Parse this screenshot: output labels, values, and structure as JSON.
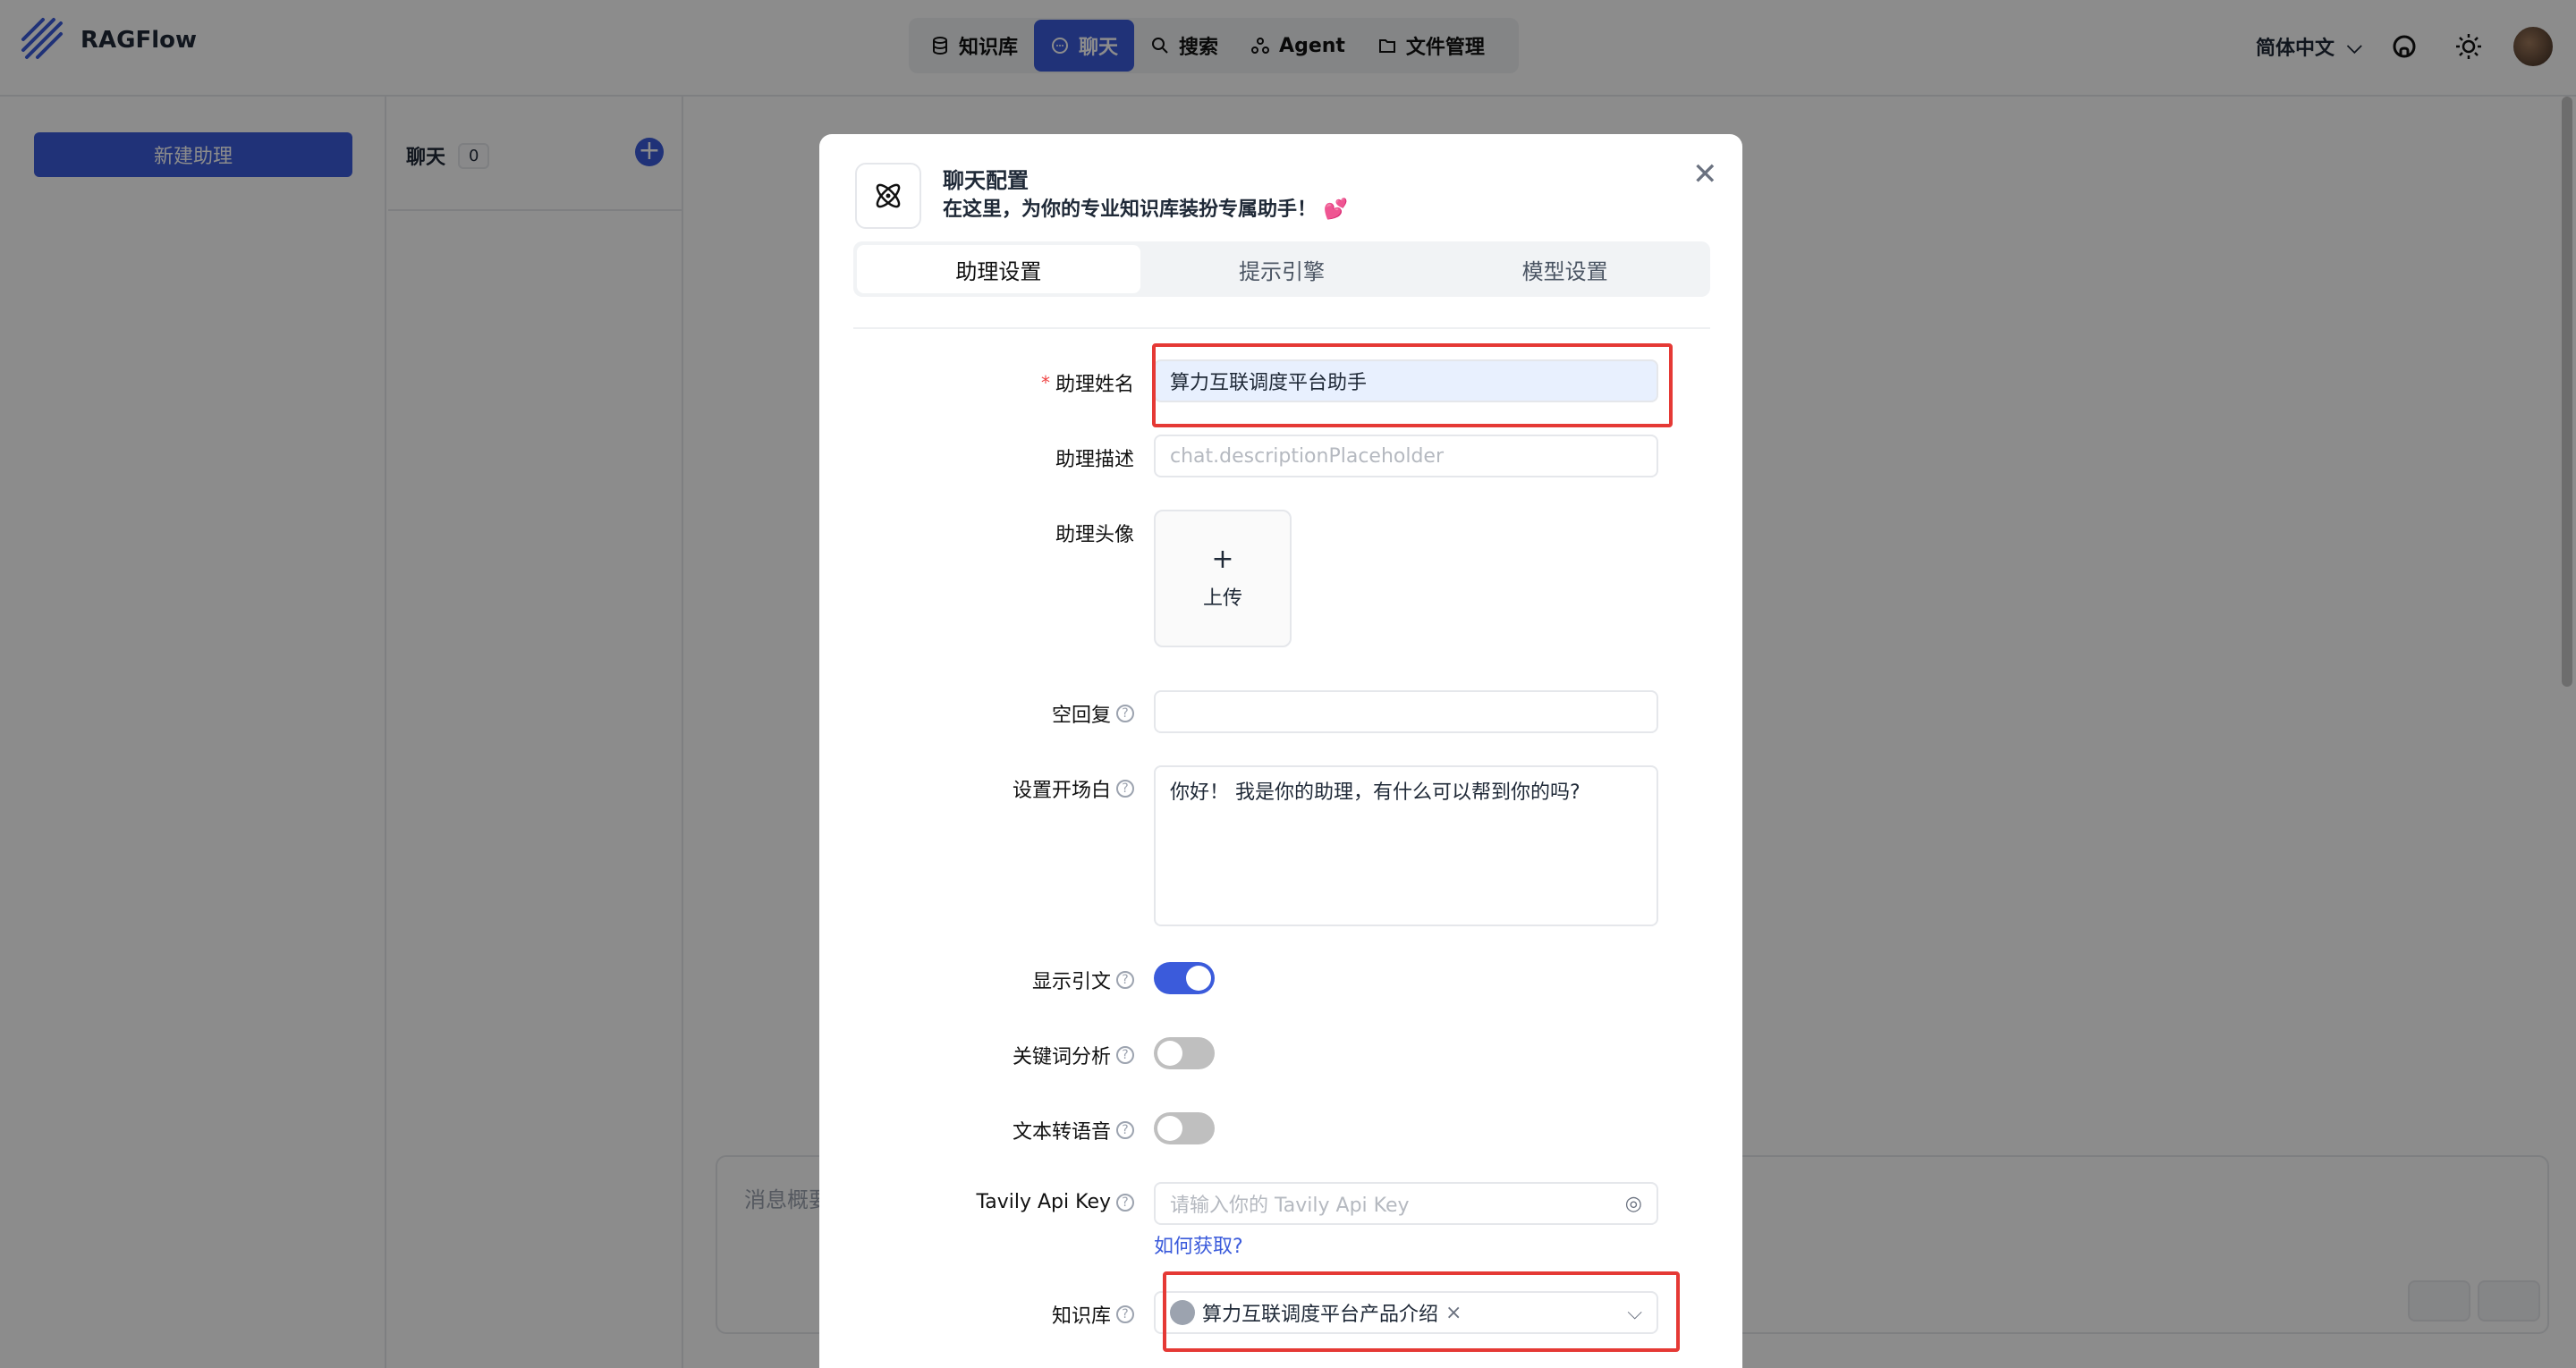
{
  "app": {
    "brand": "RAGFlow"
  },
  "nav": {
    "items": [
      {
        "label": "知识库",
        "icon": "database-icon"
      },
      {
        "label": "聊天",
        "icon": "chat-icon",
        "active": true
      },
      {
        "label": "搜索",
        "icon": "search-icon"
      },
      {
        "label": "Agent",
        "icon": "agent-icon"
      },
      {
        "label": "文件管理",
        "icon": "folder-icon"
      }
    ]
  },
  "header": {
    "language": "简体中文"
  },
  "sidebar": {
    "new_assistant": "新建助理"
  },
  "chats": {
    "title": "聊天",
    "count": "0"
  },
  "message": {
    "placeholder": "消息概要"
  },
  "modal": {
    "title": "聊天配置",
    "subtitle": "在这里，为你的专业知识库装扮专属助手！ 💕",
    "tabs": [
      "助理设置",
      "提示引擎",
      "模型设置"
    ],
    "fields": {
      "name_label": "助理姓名",
      "name_value": "算力互联调度平台助手",
      "desc_label": "助理描述",
      "desc_placeholder": "chat.descriptionPlaceholder",
      "avatar_label": "助理头像",
      "upload_label": "上传",
      "empty_label": "空回复",
      "opener_label": "设置开场白",
      "opener_value": "你好！ 我是你的助理，有什么可以帮到你的吗?",
      "quote_label": "显示引文",
      "quote_on": true,
      "keyword_label": "关键词分析",
      "keyword_on": false,
      "tts_label": "文本转语音",
      "tts_on": false,
      "tavily_label": "Tavily Api Key",
      "tavily_placeholder": "请输入你的 Tavily Api Key",
      "tavily_link": "如何获取?",
      "kb_label": "知识库",
      "kb_value": "算力互联调度平台产品介绍"
    }
  },
  "colors": {
    "accent": "#3b5bdb",
    "highlight": "#e53935"
  }
}
